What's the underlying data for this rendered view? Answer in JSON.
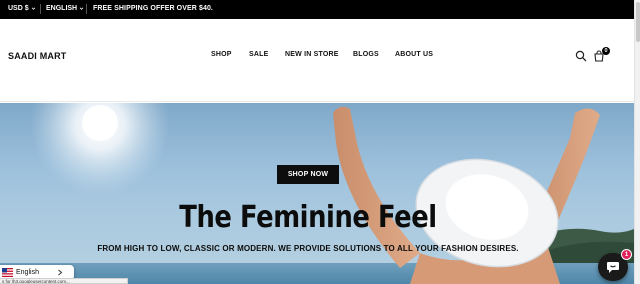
{
  "topbar": {
    "currency": "USD $",
    "language": "ENGLISH",
    "promo": "FREE SHIPPING OFFER OVER $40."
  },
  "header": {
    "logo": "SAADI MART",
    "nav": [
      "SHOP",
      "SALE",
      "NEW IN STORE",
      "BLOGS",
      "ABOUT US"
    ],
    "icons": [
      "search-icon",
      "cart-icon"
    ],
    "cart_count": "0"
  },
  "hero": {
    "title": "The Feminine Feel",
    "subtitle": "FROM HIGH TO LOW, CLASSIC OR MODERN. WE PROVIDE SOLUTIONS TO ALL YOUR FASHION DESIRES.",
    "cta": "SHOP NOW"
  },
  "language_selector": {
    "label": "English",
    "flag": "us-flag-icon"
  },
  "status_url": "s for lh3.googleusercontent.com...",
  "chat": {
    "badge_count": "1",
    "icon": "chat-icon"
  },
  "colors": {
    "topbar_bg": "#000000",
    "cta_bg": "#0d0d0d",
    "chat_badge": "#e0215b",
    "hero_sky": "#9cc0dc"
  }
}
